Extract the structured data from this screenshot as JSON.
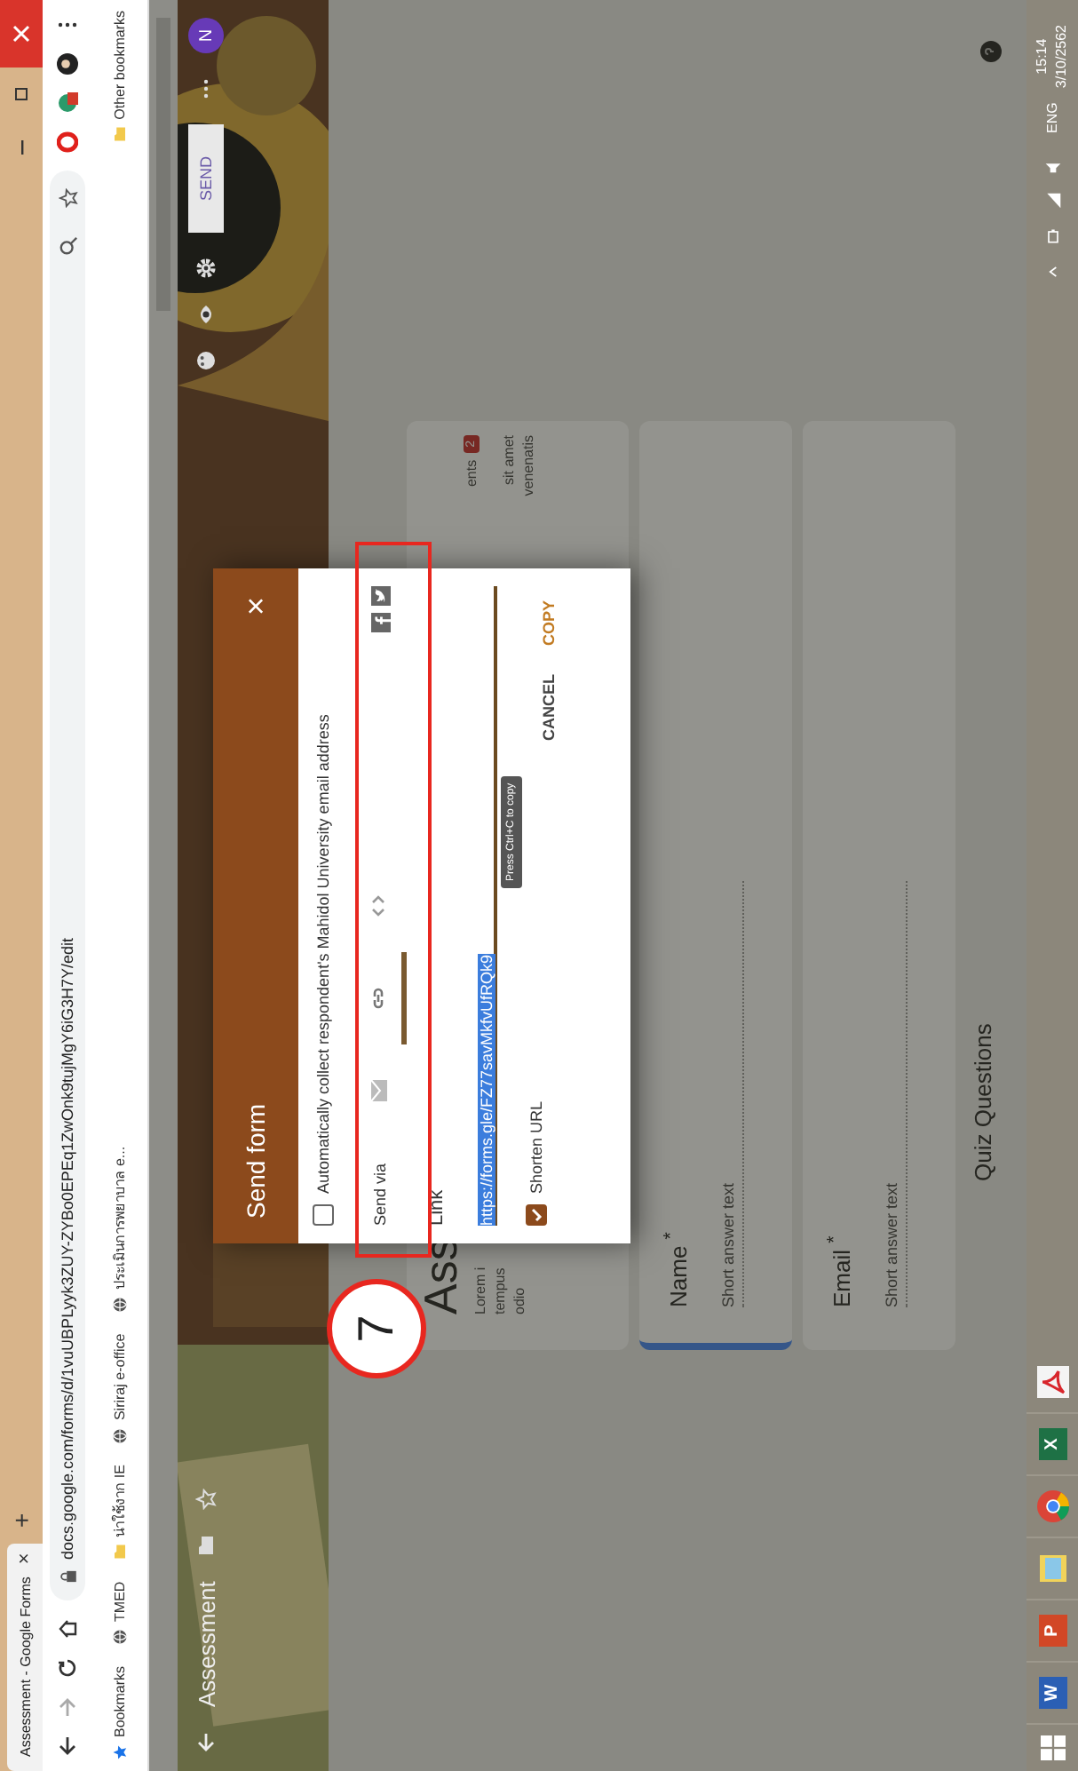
{
  "browser": {
    "tab": {
      "title": "Assessment - Google Forms",
      "close": "×"
    },
    "new_tab": "+",
    "url": "docs.google.com/forms/d/1vuUBPLyyk3ZUY-ZYBo0EPEq1ZwOnk9tujMgY6iG3H7Y/edit",
    "bookmarks": [
      {
        "label": "Bookmarks",
        "kind": "star"
      },
      {
        "label": "TMED",
        "kind": "globe"
      },
      {
        "label": "น่าใช้งาก IE",
        "kind": "folder"
      },
      {
        "label": "Siriraj e-office",
        "kind": "globe"
      },
      {
        "label": "ประเมินการพยาบาล e...",
        "kind": "globe"
      }
    ],
    "other_bookmarks": "Other bookmarks"
  },
  "form_header": {
    "title": "Assessment",
    "send": "SEND",
    "avatar": "N"
  },
  "form": {
    "title": "Ass",
    "description_left": [
      "Lorem i",
      "tempus",
      "odio"
    ],
    "description_right": [
      "sit amet",
      "venenatis"
    ],
    "responses_tab": "ents",
    "responses_count": "2",
    "questions": [
      {
        "label": "Name $^{*}$",
        "placeholder": "Short answer text",
        "selected": true
      },
      {
        "label": "Email $^{*}$",
        "placeholder": "Short answer text",
        "selected": false
      }
    ],
    "section": "Quiz Questions"
  },
  "dialog": {
    "title": "Send form",
    "close": "×",
    "collect_email": {
      "label": "Automatically collect respondent's Mahidol University email address",
      "checked": false
    },
    "send_via_label": "Send via",
    "methods": [
      {
        "kind": "email",
        "selected": false
      },
      {
        "kind": "link",
        "selected": true
      },
      {
        "kind": "embed",
        "selected": false
      }
    ],
    "social": [
      {
        "kind": "facebook"
      },
      {
        "kind": "twitter"
      }
    ],
    "section": "Link",
    "url": "https://forms.gle/FZ77savMkfvUfRQk9",
    "tooltip": "Press Ctrl+C to copy",
    "shorten": {
      "label": "Shorten URL",
      "checked": true
    },
    "buttons": [
      "CANCEL",
      "COPY"
    ]
  },
  "annotation": {
    "number": "7"
  },
  "taskbar": {
    "apps": [
      {
        "kind": "word",
        "label": "W"
      },
      {
        "kind": "powerpoint",
        "label": "P"
      },
      {
        "kind": "files"
      },
      {
        "kind": "chrome"
      },
      {
        "kind": "excel",
        "label": "X"
      },
      {
        "kind": "acrobat"
      }
    ],
    "language": "ENG",
    "time": "15:14",
    "date": "3/10/2562"
  }
}
